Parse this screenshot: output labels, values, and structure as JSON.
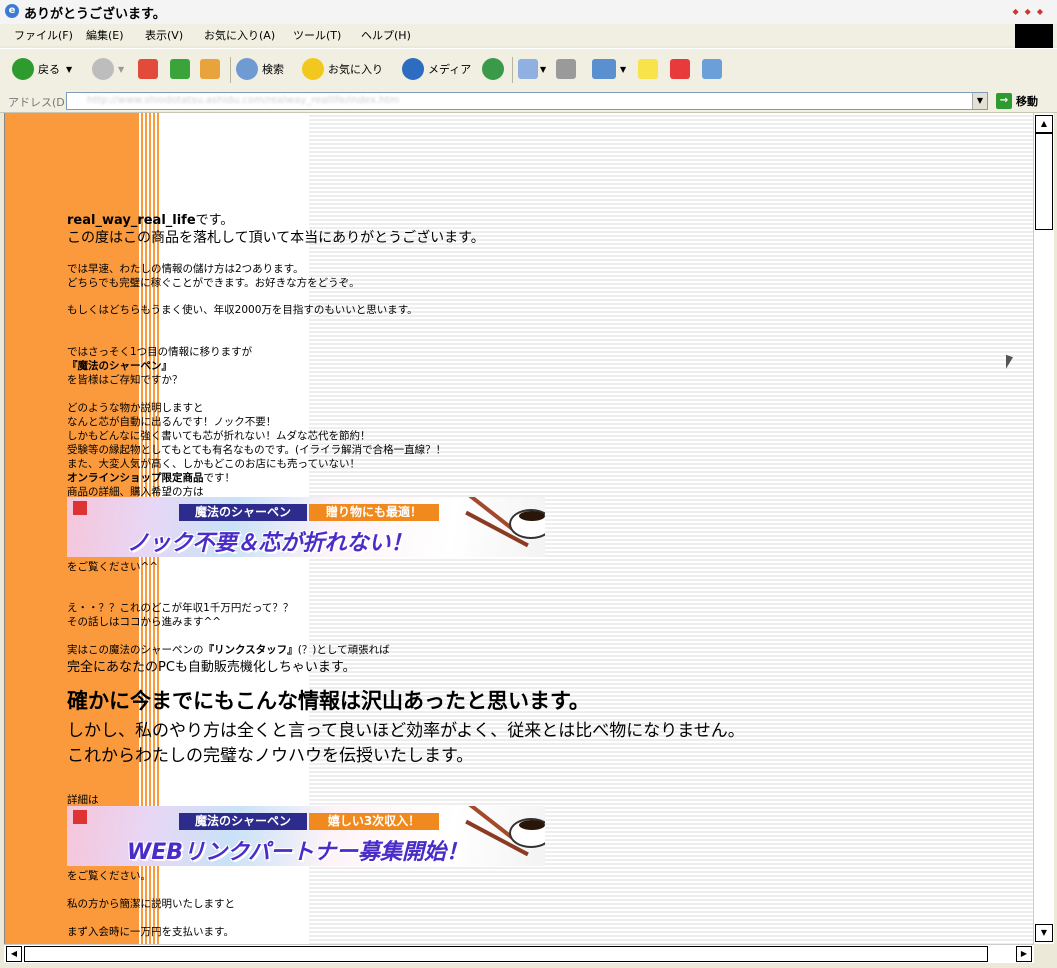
{
  "window": {
    "title": "ありがとうございます。"
  },
  "menu": [
    "ファイル(F)",
    "編集(E)",
    "表示(V)",
    "お気に入り(A)",
    "ツール(T)",
    "ヘルプ(H)"
  ],
  "toolbar": {
    "back": "戻る",
    "search": "検索",
    "favorites": "お気に入り",
    "media": "メディア"
  },
  "address": {
    "label": "アドレス(D)",
    "url": "http://www.shiodotatsu.ashidu.com/realway_reallife/index.htm",
    "go": "移動"
  },
  "page": {
    "intro_name": "real_way_real_life",
    "intro_desu": "です。",
    "thanks": "この度はこの商品を落札して頂いて本当にありがとうございます。",
    "p1": "では早速、わたしの情報の儲け方は2つあります。",
    "p2": "どちらでも完璧に稼ぐことができます。お好きな方をどうぞ。",
    "p3": "もしくはどちらもうまく使い、年収2000万を目指すのもいいと思います。",
    "p4": "ではさっそく1つ目の情報に移りますが",
    "p5": "『魔法のシャーペン』",
    "p6": "を皆様はご存知ですか？",
    "p7": "どのような物か説明しますと",
    "p8": "なんと芯が自動に出るんです！ノック不要！",
    "p9": "しかもどんなに強く書いても芯が折れない！ムダな芯代を節約！",
    "p10": "受験等の縁起物としてもとても有名なものです。(イライラ解消で合格一直線？！",
    "p11": "また、大変人気が高く、しかもどこのお店にも売っていない！",
    "p12_bold": "オンラインショップ限定商品",
    "p12_rest": "です！",
    "p13": "商品の詳細、購入希望の方は",
    "banner1": {
      "tag": "魔法のシャーペン",
      "tag2": "贈り物にも最適！",
      "main": "ノック不要＆芯が折れない！"
    },
    "p14": "をご覧ください^^",
    "p15": "え・・？？これのどこが年収1千万円だって？？",
    "p16": "その話しはココから進みます^^",
    "p17a": "実はこの魔法のシャーペンの",
    "p17b": "『リンクスタッフ』",
    "p17c": "(？)として頑張れば",
    "p18": "完全にあなたのPCも自動販売機化しちゃいます。",
    "p19": "確かに今までにもこんな情報は沢山あったと思います。",
    "p20": "しかし、私のやり方は全くと言って良いほど効率がよく、従来とは比べ物になりません。",
    "p21": "これからわたしの完璧なノウハウを伝授いたします。",
    "p22": "詳細は",
    "banner2": {
      "tag": "魔法のシャーペン",
      "tag2": "嬉しい3次収入！",
      "main": "WEBリンクパートナー募集開始！"
    },
    "p23": "をご覧ください。",
    "p24": "私の方から簡潔に説明いたしますと",
    "p25": "まず入会時に一万円を支払います。"
  }
}
